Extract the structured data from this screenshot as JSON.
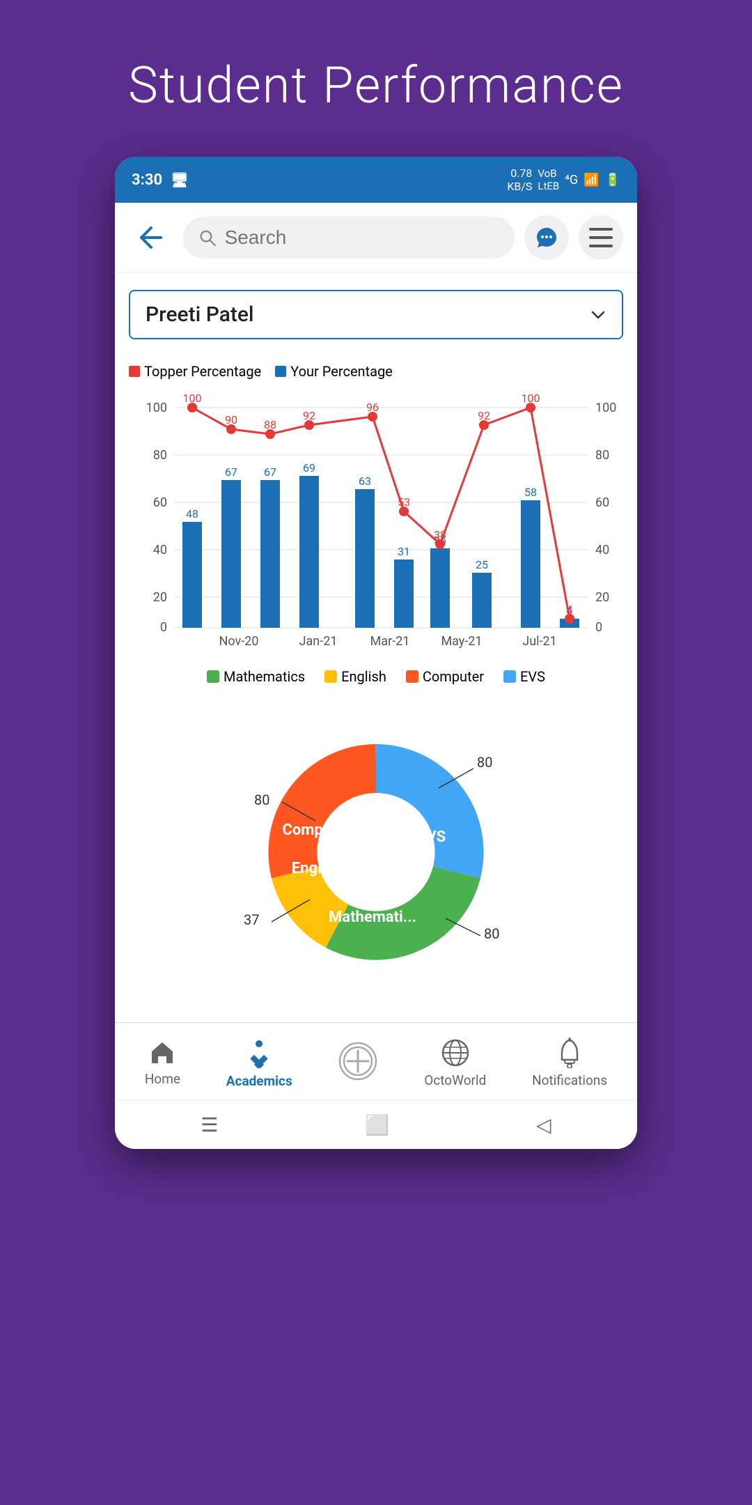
{
  "page": {
    "title": "Student Performance",
    "background_color": "#5b2d8e"
  },
  "status_bar": {
    "time": "3:30",
    "network_speed": "0.78\nKB/S",
    "network_type": "4G",
    "battery": "6"
  },
  "top_bar": {
    "search_placeholder": "Search",
    "back_label": "back"
  },
  "student_selector": {
    "name": "Preeti Patel",
    "dropdown_label": "dropdown"
  },
  "bar_chart": {
    "legend": [
      {
        "label": "Topper Percentage",
        "color": "#e53935"
      },
      {
        "label": "Your Percentage",
        "color": "#1a6fb5"
      }
    ],
    "months": [
      "Nov-20",
      "Jan-21",
      "Mar-21",
      "May-21",
      "Jul-21"
    ],
    "topper_line": [
      100,
      88,
      96,
      38,
      100
    ],
    "topper_labels": [
      100,
      90,
      88,
      92,
      96,
      53,
      38,
      92,
      100,
      4
    ],
    "bar_values": [
      48,
      67,
      67,
      69,
      63,
      31,
      36,
      25,
      58,
      4
    ],
    "y_axis": [
      0,
      20,
      40,
      60,
      80,
      100
    ],
    "subjects": [
      {
        "label": "Mathematics",
        "color": "#4caf50"
      },
      {
        "label": "English",
        "color": "#ffc107"
      },
      {
        "label": "Computer",
        "color": "#ff5722"
      },
      {
        "label": "EVS",
        "color": "#42a5f5"
      }
    ]
  },
  "donut_chart": {
    "segments": [
      {
        "label": "EVS",
        "value": 80,
        "color": "#42a5f5",
        "angle_start": -90,
        "angle_end": 90
      },
      {
        "label": "Mathematics",
        "value": 80,
        "color": "#4caf50",
        "angle_start": 90,
        "angle_end": 180
      },
      {
        "label": "English",
        "value": 37,
        "color": "#ffc107",
        "angle_start": 180,
        "angle_end": 260
      },
      {
        "label": "Computer",
        "value": 80,
        "color": "#ff5722",
        "angle_start": 260,
        "angle_end": 360
      }
    ],
    "labels_outside": [
      {
        "text": "80",
        "position": "top-right"
      },
      {
        "text": "80",
        "position": "right"
      },
      {
        "text": "80",
        "position": "left"
      },
      {
        "text": "37",
        "position": "bottom-left"
      }
    ]
  },
  "bottom_nav": {
    "items": [
      {
        "label": "Home",
        "icon": "home",
        "active": false
      },
      {
        "label": "Academics",
        "icon": "academics",
        "active": true
      },
      {
        "label": "",
        "icon": "octo-plus",
        "active": false
      },
      {
        "label": "OctoWorld",
        "icon": "globe",
        "active": false
      },
      {
        "label": "Notifications",
        "icon": "bell",
        "active": false
      }
    ]
  }
}
